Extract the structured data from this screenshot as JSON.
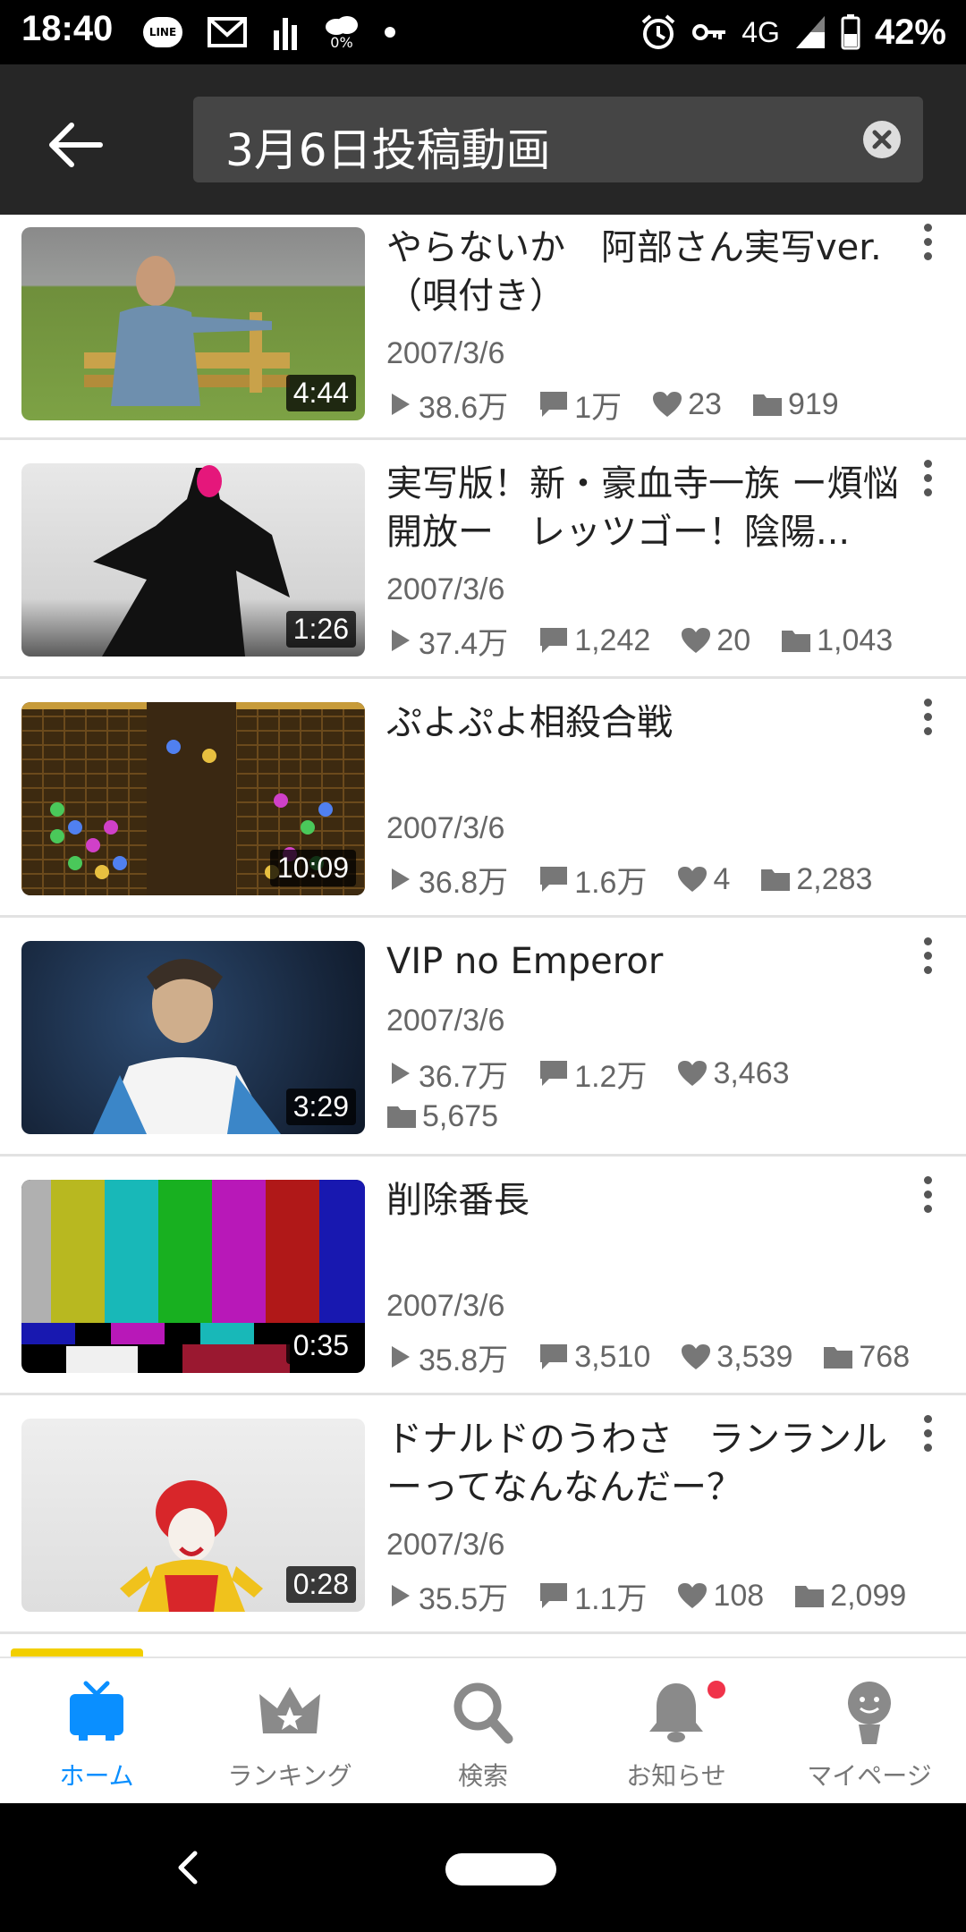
{
  "status_bar": {
    "time": "18:40",
    "network": "4G",
    "battery": "42%",
    "data_pct": "0%",
    "line_label": "LINE"
  },
  "header": {
    "search_text": "3月6日投稿動画"
  },
  "videos": [
    {
      "title": "やらないか　阿部さん実写ver.（唄付き）",
      "date": "2007/3/6",
      "duration": "4:44",
      "views": "38.6万",
      "comments": "1万",
      "likes": "23",
      "mylists": "919"
    },
    {
      "title": "実写版！新・豪血寺一族 ー煩悩開放ー　レッツゴー！陰陽...",
      "date": "2007/3/6",
      "duration": "1:26",
      "views": "37.4万",
      "comments": "1,242",
      "likes": "20",
      "mylists": "1,043"
    },
    {
      "title": "ぷよぷよ相殺合戦",
      "date": "2007/3/6",
      "duration": "10:09",
      "views": "36.8万",
      "comments": "1.6万",
      "likes": "4",
      "mylists": "2,283"
    },
    {
      "title": "VIP no Emperor",
      "date": "2007/3/6",
      "duration": "3:29",
      "views": "36.7万",
      "comments": "1.2万",
      "likes": "3,463",
      "mylists": "5,675"
    },
    {
      "title": "削除番長",
      "date": "2007/3/6",
      "duration": "0:35",
      "views": "35.8万",
      "comments": "3,510",
      "likes": "3,539",
      "mylists": "768"
    },
    {
      "title": "ドナルドのうわさ　ランランルーってなんなんだー？",
      "date": "2007/3/6",
      "duration": "0:28",
      "views": "35.5万",
      "comments": "1.1万",
      "likes": "108",
      "mylists": "2,099"
    }
  ],
  "bottom_nav": [
    {
      "label": "ホーム",
      "icon": "tv-icon",
      "active": true
    },
    {
      "label": "ランキング",
      "icon": "crown-icon"
    },
    {
      "label": "検索",
      "icon": "search-icon"
    },
    {
      "label": "お知らせ",
      "icon": "bell-icon",
      "badge": true
    },
    {
      "label": "マイページ",
      "icon": "user-icon"
    }
  ],
  "colors": {
    "accent": "#0a8fff",
    "header_bg": "#262626",
    "search_bg": "#454545",
    "badge": "#f0334a"
  }
}
